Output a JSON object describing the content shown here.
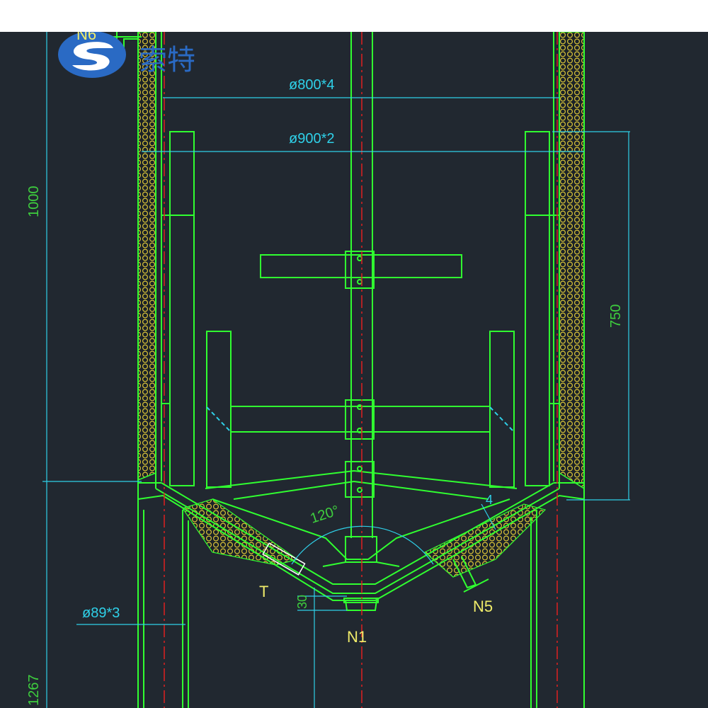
{
  "brand": {
    "name": "索特",
    "logo_icon": "s-swoosh-logo-icon",
    "color": "#2a6ac4"
  },
  "labels": {
    "n6": "N6",
    "d800": "ø800*4",
    "d900": "ø900*2",
    "h1000": "1000",
    "h750": "750",
    "angle120": "120°",
    "t": "T",
    "n5": "N5",
    "n1": "N1",
    "h30": "30",
    "d89": "ø89*3",
    "h1267": "1267",
    "thk4": "4"
  },
  "colors": {
    "background": "#212830",
    "structure": "#30ff30",
    "dimension": "#2fd0e8",
    "centerline": "#e02020",
    "insulation": "#d8c238"
  }
}
